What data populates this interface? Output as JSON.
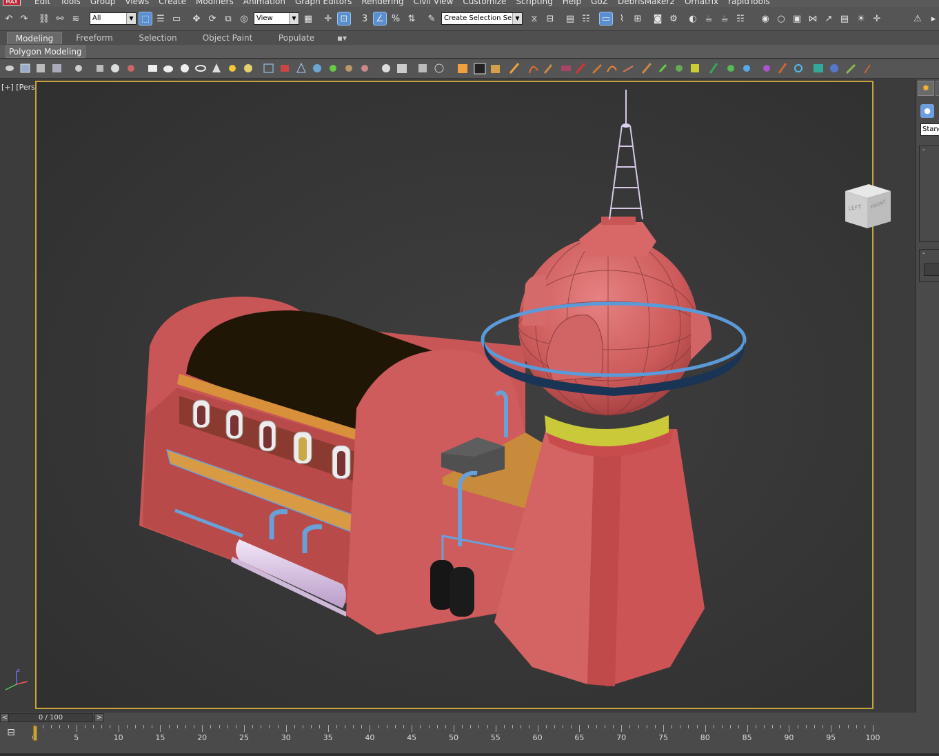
{
  "app": {
    "logo": "MAX"
  },
  "menu": [
    "Edit",
    "Tools",
    "Group",
    "Views",
    "Create",
    "Modifiers",
    "Animation",
    "Graph Editors",
    "Rendering",
    "Civil View",
    "Customize",
    "Scripting",
    "Help",
    "GoZ",
    "DebrisMaker2",
    "Ornatrix",
    "rapidTools"
  ],
  "toolbar": {
    "selection_filter": "All",
    "reference_coord": "View",
    "named_selection": "Create Selection Se"
  },
  "ribbon": {
    "tabs": [
      "Modeling",
      "Freeform",
      "Selection",
      "Object Paint",
      "Populate"
    ],
    "active_tab": "Modeling",
    "panel_label": "Polygon Modeling"
  },
  "viewport": {
    "label": "[+] [Perspective ] [Shaded ]",
    "viewcube": {
      "left": "LEFT",
      "front": "FRONT"
    }
  },
  "command_panel": {
    "dropdown": "Stanc"
  },
  "timeline": {
    "slider": "0 / 100",
    "prev": "<",
    "next": ">",
    "ruler_labels": [
      "0",
      "5",
      "10",
      "15",
      "20",
      "25",
      "30",
      "35",
      "40",
      "45",
      "50",
      "55",
      "60",
      "65",
      "70",
      "75",
      "80",
      "85",
      "90",
      "95",
      "100"
    ]
  },
  "colors": {
    "viewport_border": "#c8a23a",
    "building_red": "#c85a58",
    "active_blue": "#5a8fcf"
  }
}
